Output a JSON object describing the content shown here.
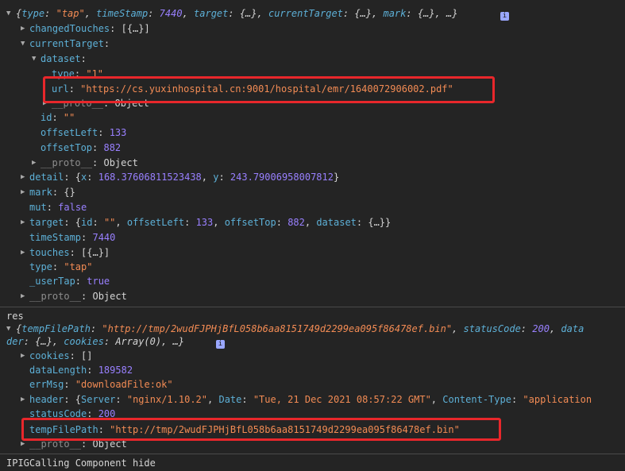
{
  "log1": {
    "summary": {
      "open": "{",
      "k_type": "type",
      "v_type": "\"tap\"",
      "k_ts": "timeStamp",
      "v_ts": "7440",
      "k_target": "target",
      "v_target": "{…}",
      "k_ct": "currentTarget",
      "v_ct": "{…}",
      "k_mark": "mark",
      "v_mark": "{…}",
      "tail": "…}"
    },
    "changedTouches": {
      "key": "changedTouches",
      "value": "[{…}]"
    },
    "currentTarget": {
      "key": "currentTarget"
    },
    "dataset": {
      "key": "dataset"
    },
    "ds_type": {
      "key": "type",
      "value": "\"1\""
    },
    "ds_url": {
      "key": "url",
      "value": "\"https://cs.yuxinhospital.cn:9001/hospital/emr/1640072906002.pdf\""
    },
    "ds_proto": {
      "key": "__proto__",
      "value": "Object"
    },
    "ct_id": {
      "key": "id",
      "value": "\"\""
    },
    "ct_offsetLeft": {
      "key": "offsetLeft",
      "value": "133"
    },
    "ct_offsetTop": {
      "key": "offsetTop",
      "value": "882"
    },
    "ct_proto": {
      "key": "__proto__",
      "value": "Object"
    },
    "detail": {
      "key": "detail",
      "x": "168.37606811523438",
      "y": "243.79006958007812"
    },
    "mark": {
      "key": "mark",
      "value": "{}"
    },
    "mut": {
      "key": "mut",
      "value": "false"
    },
    "target": {
      "key": "target",
      "k_id": "id",
      "v_id": "\"\"",
      "k_ol": "offsetLeft",
      "v_ol": "133",
      "k_ot": "offsetTop",
      "v_ot": "882",
      "k_ds": "dataset",
      "v_ds": "{…}"
    },
    "timeStamp": {
      "key": "timeStamp",
      "value": "7440"
    },
    "touches": {
      "key": "touches",
      "value": "[{…}]"
    },
    "type": {
      "key": "type",
      "value": "\"tap\""
    },
    "userTap": {
      "key": "_userTap",
      "value": "true"
    },
    "proto": {
      "key": "__proto__",
      "value": "Object"
    }
  },
  "log2": {
    "label": "res",
    "summary": {
      "k_tfp": "tempFilePath",
      "v_tfp": "\"http://tmp/2wudFJPHjBfL058b6aa8151749d2299ea095f86478ef.bin\"",
      "k_sc": "statusCode",
      "v_sc": "200",
      "k_data_cut": "data",
      "cont_prefix": "der",
      "cont_val1": "{…}",
      "k_cookies": "cookies",
      "v_cookies": "Array(0)",
      "tail": "…}"
    },
    "cookies": {
      "key": "cookies",
      "value": "[]"
    },
    "dataLength": {
      "key": "dataLength",
      "value": "189582"
    },
    "errMsg": {
      "key": "errMsg",
      "value": "\"downloadFile:ok\""
    },
    "header": {
      "key": "header",
      "k_server": "Server",
      "v_server": "\"nginx/1.10.2\"",
      "k_date": "Date",
      "v_date": "\"Tue, 21 Dec 2021 08:57:22 GMT\"",
      "k_ct": "Content-Type",
      "v_ct": "\"application"
    },
    "statusCode": {
      "key": "statusCode",
      "value": "200"
    },
    "tempFilePath": {
      "key": "tempFilePath",
      "value": "\"http://tmp/2wudFJPHjBfL058b6aa8151749d2299ea095f86478ef.bin\""
    },
    "proto": {
      "key": "__proto__",
      "value": "Object"
    }
  },
  "log3": {
    "text": "IPIGCalling Component hide"
  },
  "colors": {
    "highlight": "#e8272b",
    "key": "#5db0d7",
    "string": "#f28b54",
    "number": "#9980ff"
  }
}
